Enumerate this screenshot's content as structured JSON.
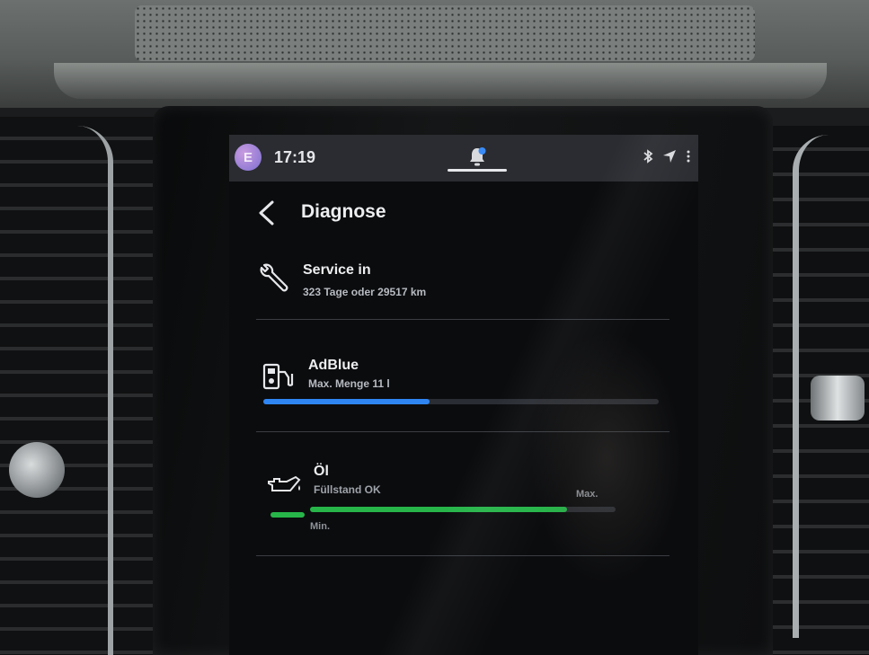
{
  "status_bar": {
    "avatar_letter": "E",
    "time": "17:19",
    "icons": [
      "bell-icon",
      "bluetooth-icon",
      "location-icon",
      "more-icon"
    ]
  },
  "header": {
    "title": "Diagnose"
  },
  "service": {
    "title": "Service in",
    "subtitle": "323 Tage oder 29517 km"
  },
  "adblue": {
    "title": "AdBlue",
    "subtitle": "Max. Menge 11 l",
    "fill_fraction": 0.42
  },
  "oil": {
    "title": "Öl",
    "subtitle": "Füllstand OK",
    "min_label": "Min.",
    "max_label": "Max.",
    "fill_fraction": 0.84
  },
  "colors": {
    "adblue_bar": "#2f86f3",
    "oil_bar": "#27b54a"
  }
}
